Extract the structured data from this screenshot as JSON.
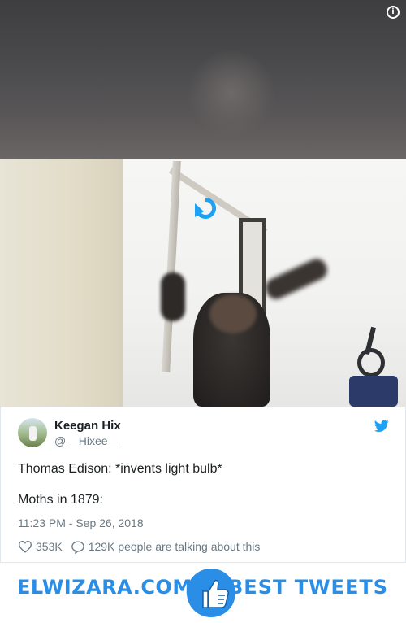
{
  "tweet": {
    "display_name": "Keegan Hix",
    "handle": "@__Hixee__",
    "text_line1": "Thomas Edison: *invents light bulb*",
    "text_line2": "Moths in 1879:",
    "timestamp": "11:23 PM - Sep 26, 2018",
    "likes": "353K",
    "talking": "129K people are talking about this"
  },
  "media": {
    "info_glyph": "i",
    "icons": [
      "info-icon",
      "play-icon"
    ]
  },
  "banner": {
    "left_text": "ELWIZARA.COM",
    "right_text": "BEST TWEETS",
    "icon": "thumbs-up-icon"
  },
  "colors": {
    "twitter_blue": "#1da1f2",
    "brand_blue": "#2a8ee6",
    "text_primary": "#1c2022",
    "text_secondary": "#697882"
  }
}
